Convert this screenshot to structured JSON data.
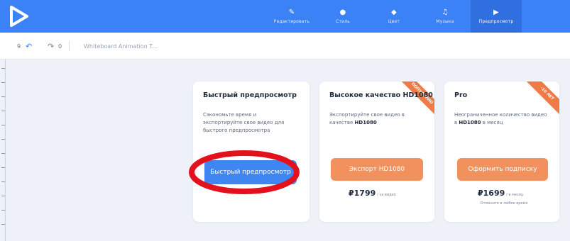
{
  "header": {
    "nav": [
      {
        "label": "Редактировать",
        "icon": "edit-icon"
      },
      {
        "label": "Стиль",
        "icon": "style-icon"
      },
      {
        "label": "Цвет",
        "icon": "color-icon"
      },
      {
        "label": "Музыка",
        "icon": "music-icon"
      },
      {
        "label": "Предпросмотр",
        "icon": "play-icon",
        "active": true
      }
    ]
  },
  "toolbar": {
    "undo_count": "9",
    "redo_count": "0",
    "title": "Whiteboard Animation T..."
  },
  "cards": [
    {
      "title": "Быстрый предпросмотр",
      "desc": "Сэкономьте время и экспортируйте свое видео для быстрого предпросмотра",
      "button": "Быстрый предпросмотр"
    },
    {
      "title": "Высокое качество HD1080",
      "desc_pre": "Экспортируйте свое видео в качестве ",
      "desc_bold": "HD1080",
      "button": "Экспорт HD1080",
      "price": "₽1799",
      "price_unit": "/ за видео",
      "ribbon": "ПОПУЛЯРНО"
    },
    {
      "title": "Pro",
      "desc_pre": "Неограниченное количество видео в ",
      "desc_bold": "HD1080",
      "desc_post": " в месяц",
      "button": "Оформить подписку",
      "price": "₽1699",
      "price_unit": "/ в месяц",
      "note": "Отмените в любое время",
      "ribbon": "-10 ЛЕТ"
    }
  ],
  "colors": {
    "topbar": "#3b82f6",
    "active_tab": "#2f6fe0",
    "blue_button": "#3f86f2",
    "orange_button": "#f2915d",
    "ribbon": "#ef7a45",
    "highlight_oval": "#e3111b"
  }
}
